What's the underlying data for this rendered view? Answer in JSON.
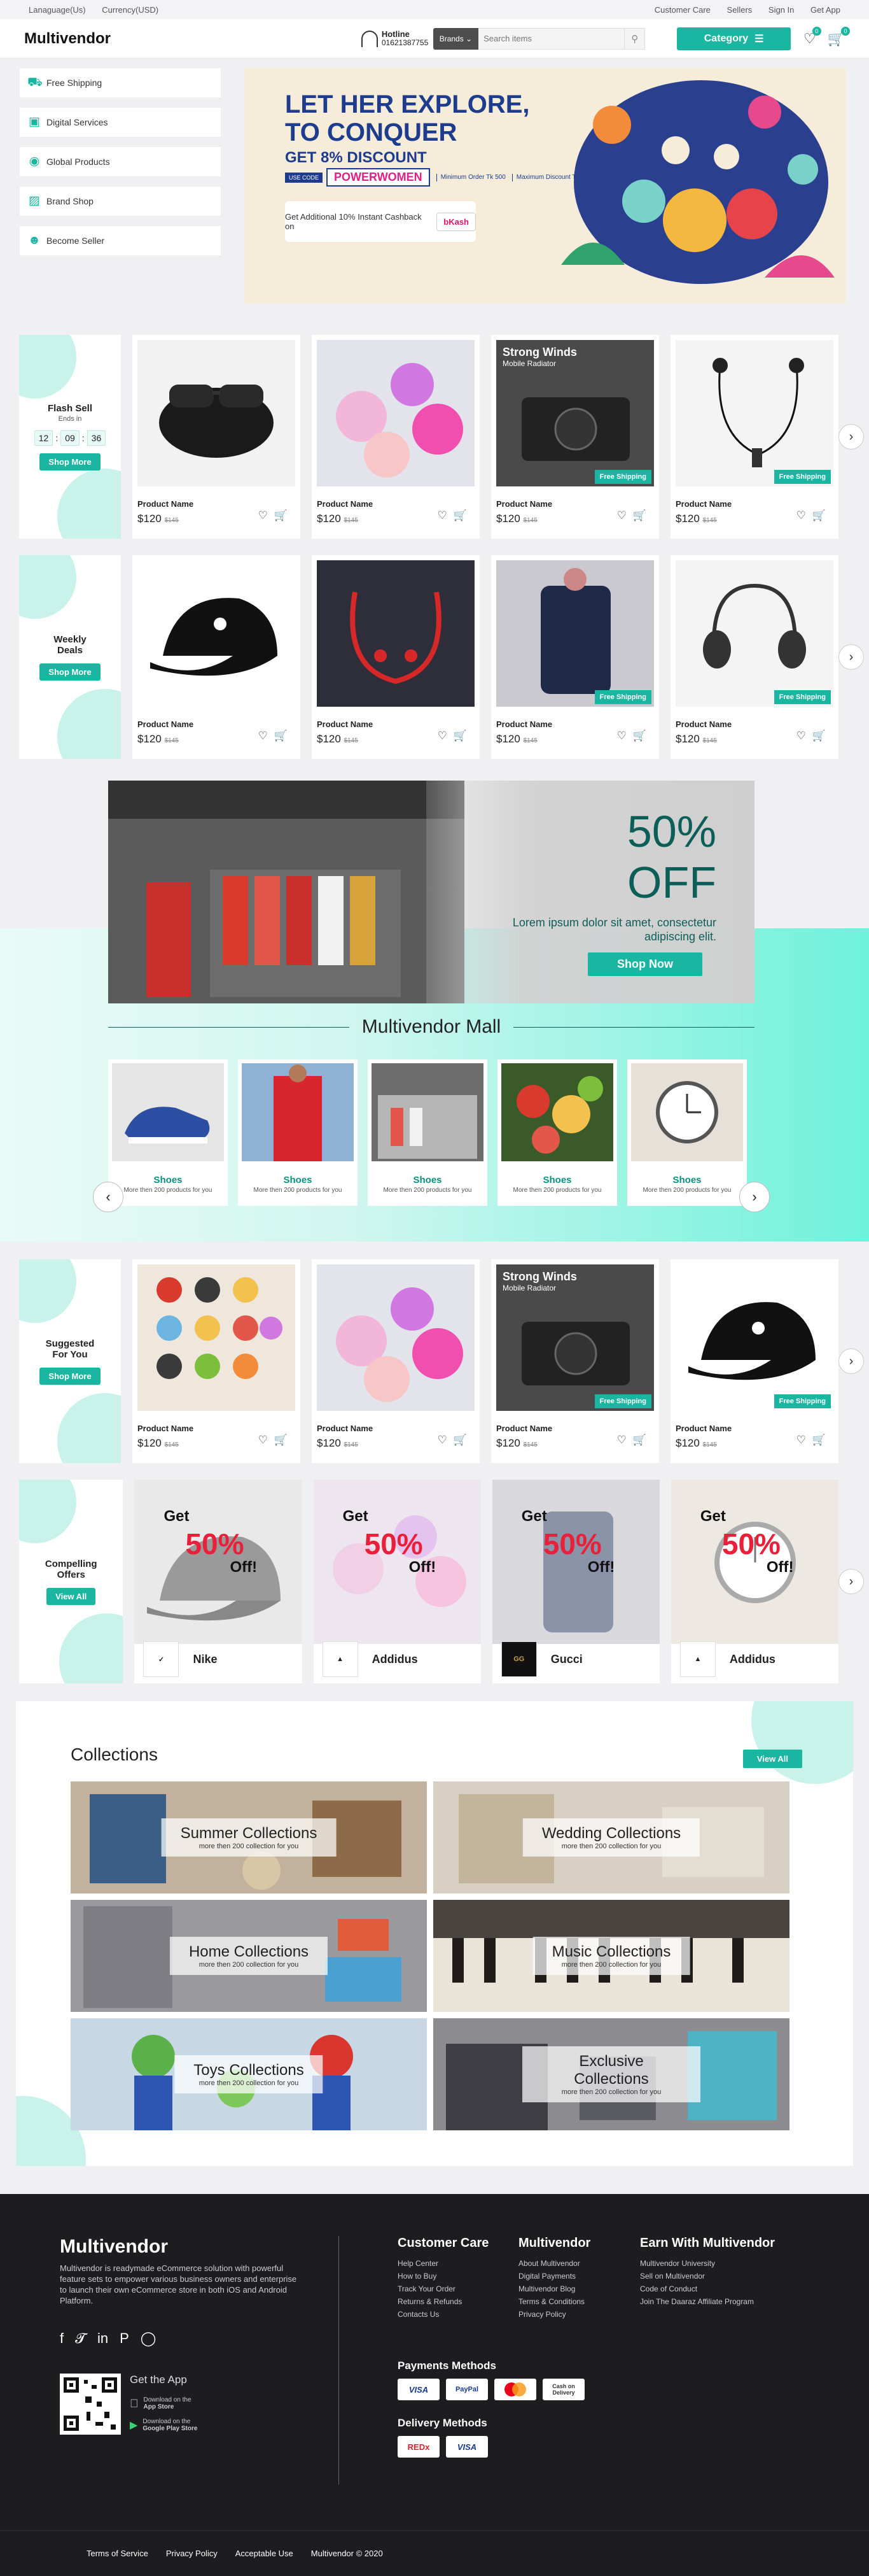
{
  "topbar": {
    "language": "Lanaguage(Us)",
    "currency": "Currency(USD)",
    "customer_care": "Customer Care",
    "sellers": "Sellers",
    "sign_in": "Sign In",
    "get_app": "Get App"
  },
  "header": {
    "logo": "Multivendor",
    "hotline_label": "Hotline",
    "hotline_number": "01621387755",
    "brands_label": "Brands",
    "search_placeholder": "Search items",
    "category_label": "Category",
    "wishlist_count": "0",
    "cart_count": "0"
  },
  "side_menu": [
    {
      "label": "Free Shipping",
      "icon": "truck-icon"
    },
    {
      "label": "Digital Services",
      "icon": "laptop-icon"
    },
    {
      "label": "Global Products",
      "icon": "globe-icon"
    },
    {
      "label": "Brand Shop",
      "icon": "bag-icon"
    },
    {
      "label": "Become Seller",
      "icon": "user-icon"
    }
  ],
  "hero": {
    "line1": "LET HER EXPLORE,",
    "line2": "TO CONQUER",
    "discount": "GET 8% DISCOUNT",
    "use_code": "USE CODE",
    "code": "POWERWOMEN",
    "min_order": "Minimum Order Tk 500",
    "max_discount": "Maximum Discount Tk 500",
    "cashback": "Get Additional 10% Instant Cashback on",
    "bkash": "bKash"
  },
  "flash": {
    "title": "Flash Sell",
    "subtitle": "Ends in",
    "hh": "12",
    "mm": "09",
    "ss": "36",
    "button": "Shop More"
  },
  "weekly": {
    "title": "Weekly Deals",
    "button": "Shop More"
  },
  "suggested": {
    "title": "Suggested For You",
    "button": "Shop More"
  },
  "compelling": {
    "title": "Compelling Offers",
    "button": "View All"
  },
  "product": {
    "name": "Product Name",
    "price": "$120",
    "old_price": "$145",
    "free_shipping": "Free Shipping",
    "strong_winds": "Strong Winds",
    "mobile_radiator": "Mobile Radiator"
  },
  "bigbanner": {
    "pct": "50%",
    "off": "OFF",
    "lorem": "Lorem ipsum dolor sit amet, consectetur adipiscing elit.",
    "button": "Shop Now"
  },
  "mall": {
    "title": "Multivendor Mall",
    "items": [
      {
        "name": "Shoes",
        "desc": "More then 200 products for you"
      },
      {
        "name": "Shoes",
        "desc": "More then 200 products for you"
      },
      {
        "name": "Shoes",
        "desc": "More then 200 products for you"
      },
      {
        "name": "Shoes",
        "desc": "More then 200 products for you"
      },
      {
        "name": "Shoes",
        "desc": "More then 200 products for you"
      }
    ]
  },
  "offers": {
    "get": "Get",
    "pct": "50%",
    "off": "Off!",
    "brands": [
      "Nike",
      "Addidus",
      "Gucci",
      "Addidus"
    ]
  },
  "collections": {
    "title": "Collections",
    "view_all": "View All",
    "items": [
      {
        "name": "Summer Collections",
        "desc": "more then 200 collection for you"
      },
      {
        "name": "Wedding Collections",
        "desc": "more then 200 collection for you"
      },
      {
        "name": "Home Collections",
        "desc": "more then 200 collection for you"
      },
      {
        "name": "Music Collections",
        "desc": "more then 200 collection for you"
      },
      {
        "name": "Toys Collections",
        "desc": "more then 200 collection for you"
      },
      {
        "name": "Exclusive Collections",
        "desc": "more then 200 collection for you"
      }
    ]
  },
  "footer": {
    "logo": "Multivendor",
    "desc": "Multivendor is readymade eCommerce solution with powerful feature sets to empower various business owners and enterprise to launch their own eCommerce store in both iOS and Android Platform.",
    "get_app": "Get the App",
    "app_store_small": "Download on the",
    "app_store": "App Store",
    "play_store_small": "Download on the",
    "play_store": "Google Play Store",
    "cc_title": "Customer Care",
    "cc_links": [
      "Help Center",
      "How to Buy",
      "Track Your Order",
      "Returns & Refunds",
      "Contacts Us"
    ],
    "mv_title": "Multivendor",
    "mv_links": [
      "About Multivendor",
      "Digital Payments",
      "Multivendor Blog",
      "Terms & Conditions",
      "Privacy Policy"
    ],
    "earn_title": "Earn With Multivendor",
    "earn_links": [
      "Multivendor University",
      "Sell on Multivendor",
      "Code of Conduct",
      "Join The Daaraz Affiliate Program"
    ],
    "payments_title": "Payments Methods",
    "payments": [
      "VISA",
      "PayPal",
      "MasterCard",
      "Cash on Delivery"
    ],
    "delivery_title": "Delivery Methods",
    "delivery": [
      "REDx",
      "VISA"
    ]
  },
  "bottombar": {
    "terms": "Terms of Service",
    "privacy": "Privacy Policy",
    "acceptable": "Acceptable Use",
    "copyright": "Multivendor © 2020"
  },
  "colors": {
    "accent": "#1bb6a1",
    "dark_teal": "#0c5f58",
    "offer_red": "#e8203a",
    "footer_bg": "#1d1d1f"
  }
}
